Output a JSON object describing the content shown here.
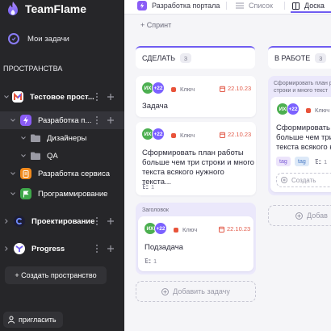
{
  "app": {
    "name": "TeamFlame"
  },
  "sidebar": {
    "my_tasks": "Мои задачи",
    "spaces_title": "ПРОСТРАНСТВА",
    "items": [
      {
        "label": "Тестовое прост...",
        "icon": "M"
      },
      {
        "label": "Разработка п..."
      },
      {
        "label": "Дизайнеры"
      },
      {
        "label": "QA"
      },
      {
        "label": "Разработка сервиса"
      },
      {
        "label": "Программирование"
      },
      {
        "label": "Проектирование"
      },
      {
        "label": "Progress"
      }
    ],
    "create_space": "+ Создать пространство",
    "invite": "пригласить"
  },
  "topbar": {
    "breadcrumb": "Разработка портала",
    "views": [
      {
        "label": "Список"
      },
      {
        "label": "Доска"
      }
    ]
  },
  "sprint": "+ Спринт",
  "columns": [
    {
      "title": "СДЕЛАТЬ",
      "count": "3"
    },
    {
      "title": "В РАБОТЕ",
      "count": "3"
    }
  ],
  "cards": {
    "c1": {
      "initials": "ИХ",
      "extra": "+22",
      "priority": "Ключ",
      "date": "22.10.23",
      "title": "Задача"
    },
    "c2": {
      "initials": "ИХ",
      "extra": "+22",
      "priority": "Ключ",
      "date": "22.10.23",
      "title_lines": [
        "Сформировать план работы",
        "больше чем три строки и много",
        "текста всякого нужного текста..."
      ],
      "subtasks": "1"
    },
    "c3": {
      "group_title": "Заголовок",
      "initials": "ИХ",
      "extra": "+22",
      "priority": "Ключ",
      "date": "22.10.23",
      "title": "Подзадача",
      "subtasks": "1"
    },
    "c4": {
      "group_lines": [
        "Сформировать план р",
        "строки и много текст"
      ],
      "initials": "ИХ",
      "extra": "+22",
      "priority": "Ключ",
      "title_lines": [
        "Сформировать п",
        "больше чем три с",
        "текста всякого н"
      ],
      "tags": [
        "tag",
        "tag"
      ],
      "subtasks": "1",
      "create_partial": "Создать"
    }
  },
  "add_task": "Добавить задачу",
  "add_partial": "Добав",
  "colors": {
    "sidebar": "#262629",
    "accent": "#6f5cf1",
    "date": "#e25b4a",
    "priority": "#e8533a"
  }
}
